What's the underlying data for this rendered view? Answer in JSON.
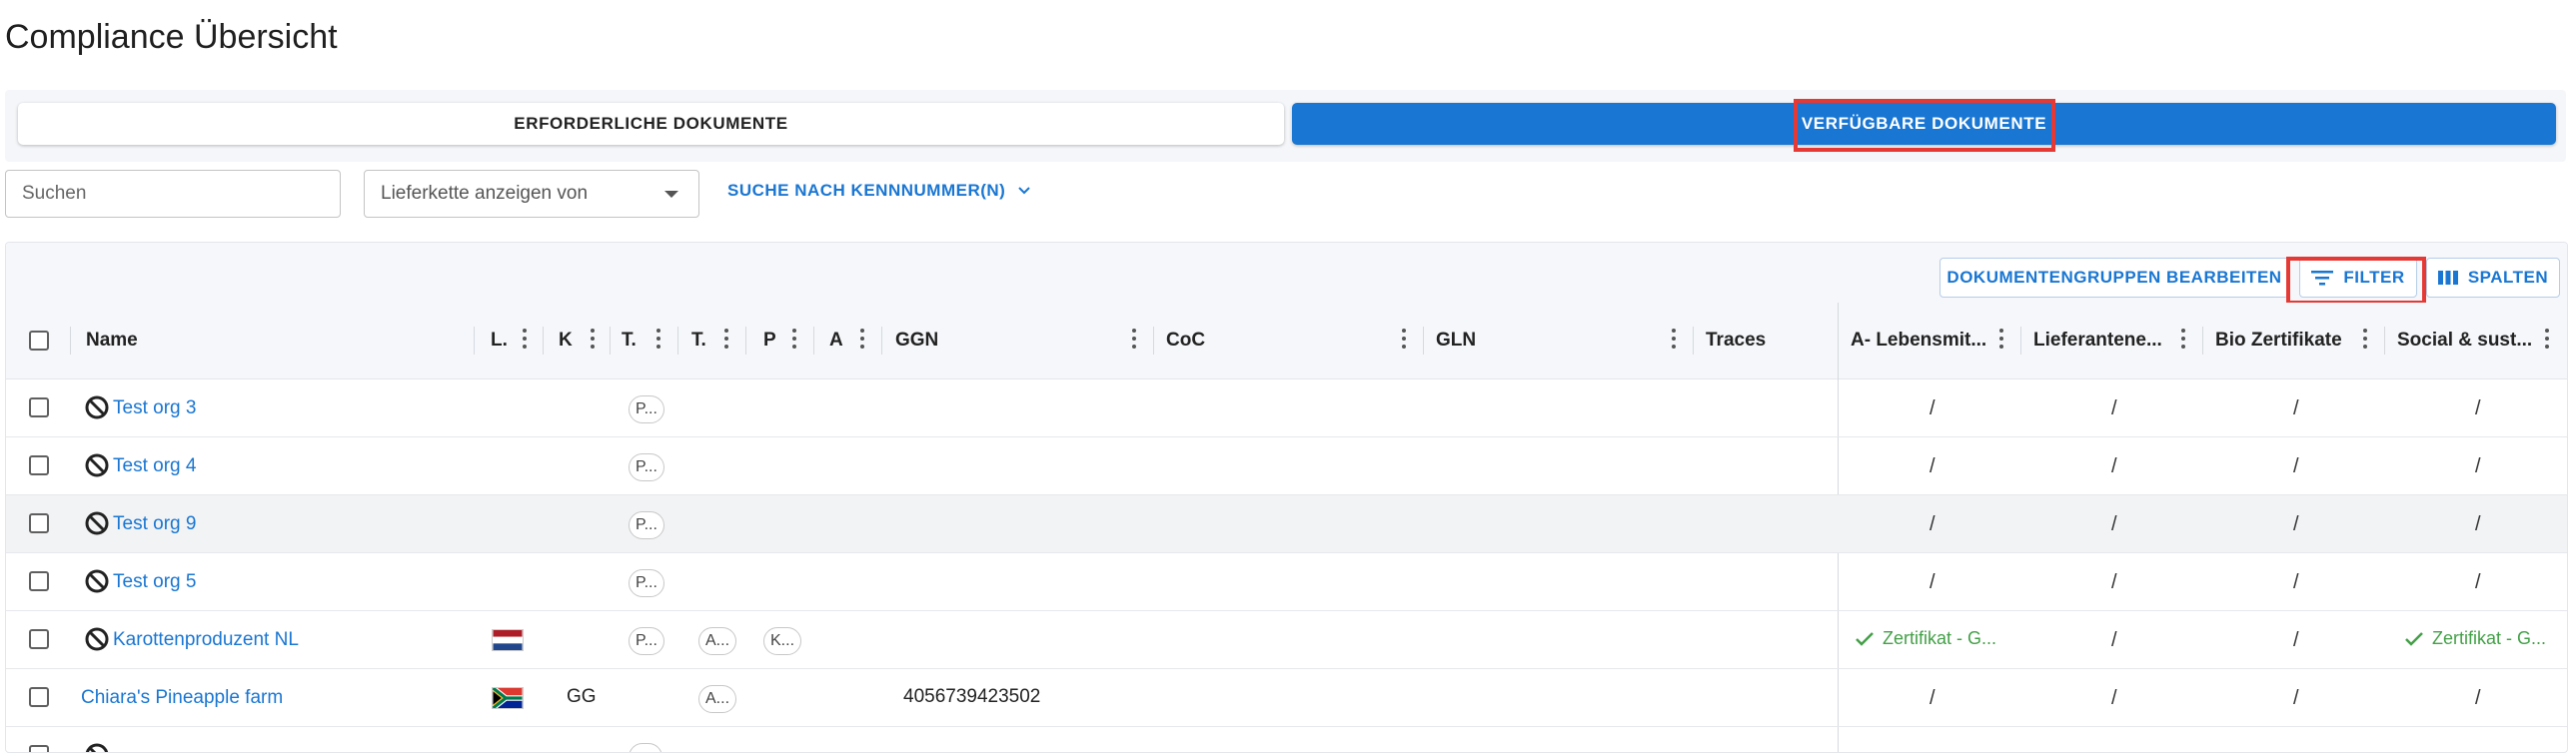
{
  "page": {
    "title": "Compliance Übersicht"
  },
  "tabs": {
    "required": "ERFORDERLICHE DOKUMENTE",
    "available": "VERFÜGBARE DOKUMENTE"
  },
  "filters": {
    "search_placeholder": "Suchen",
    "supply_chain_select": "Lieferkette anzeigen von",
    "id_search": "SUCHE NACH KENNNUMMER(N)"
  },
  "toolbar": {
    "edit_groups": "DOKUMENTENGRUPPEN BEARBEITEN",
    "filter": "FILTER",
    "columns": "SPALTEN"
  },
  "columns": {
    "name": "Name",
    "l": "L.",
    "k": "K",
    "t1": "T.",
    "t2": "T.",
    "p": "P",
    "a": "A",
    "ggn": "GGN",
    "coc": "CoC",
    "gln": "GLN",
    "traces": "Traces",
    "a_lebensmittel": "A- Lebensmit...",
    "lieferanten": "Lieferantene...",
    "bio": "Bio Zertifikate",
    "social": "Social & sust..."
  },
  "rows": [
    {
      "name": "Test org 3",
      "chip_t": "P...",
      "doc1": "/",
      "doc2": "/",
      "doc3": "/",
      "doc4": "/"
    },
    {
      "name": "Test org 4",
      "chip_t": "P...",
      "doc1": "/",
      "doc2": "/",
      "doc3": "/",
      "doc4": "/"
    },
    {
      "name": "Test org 9",
      "chip_t": "P...",
      "doc1": "/",
      "doc2": "/",
      "doc3": "/",
      "doc4": "/"
    },
    {
      "name": "Test org 5",
      "chip_t": "P...",
      "doc1": "/",
      "doc2": "/",
      "doc3": "/",
      "doc4": "/"
    },
    {
      "name": "Karottenproduzent NL",
      "flag": "Netherlands",
      "chip_t": "P...",
      "chip_p": "A...",
      "chip_a": "K...",
      "doc1": "Zertifikat - G...",
      "doc2": "/",
      "doc3": "/",
      "doc4": "Zertifikat - G..."
    },
    {
      "name": "Chiara's Pineapple farm",
      "flag": "South Africa",
      "k": "GG",
      "chip_t2": "A...",
      "ggn": "4056739423502",
      "doc1": "/",
      "doc2": "/",
      "doc3": "/",
      "doc4": "/"
    }
  ],
  "colors": {
    "accent": "#1976d2",
    "highlight": "#e53935",
    "success": "#43a047"
  }
}
